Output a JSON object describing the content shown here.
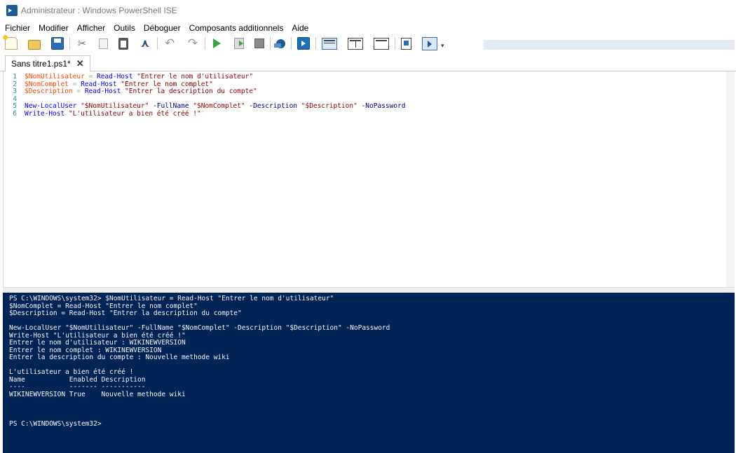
{
  "window": {
    "title": "Administrateur : Windows PowerShell ISE"
  },
  "menu": {
    "items": [
      "Fichier",
      "Modifier",
      "Afficher",
      "Outils",
      "Déboguer",
      "Composants additionnels",
      "Aide"
    ]
  },
  "toolbar": {
    "icons": [
      "new-script",
      "open",
      "save",
      "cut",
      "copy",
      "paste",
      "clear-console",
      "undo",
      "redo",
      "run-script",
      "run-selection",
      "stop",
      "new-remote-tab",
      "start-powershell",
      "show-script-top",
      "show-script-right",
      "show-script-maximized",
      "show-snippets",
      "show-commands-addon"
    ]
  },
  "tabs": [
    {
      "label": "Sans titre1.ps1*",
      "close": "✕"
    }
  ],
  "editor": {
    "line_numbers": [
      "1",
      "2",
      "3",
      "4",
      "5",
      "6"
    ],
    "lines": [
      [
        {
          "t": "var",
          "v": "$NomUtilisateur"
        },
        {
          "t": "op",
          "v": " = "
        },
        {
          "t": "cmd",
          "v": "Read-Host"
        },
        {
          "t": "plain",
          "v": " "
        },
        {
          "t": "str",
          "v": "\"Entrer le nom d'utilisateur\""
        }
      ],
      [
        {
          "t": "var",
          "v": "$NomComplet"
        },
        {
          "t": "op",
          "v": " = "
        },
        {
          "t": "cmd",
          "v": "Read-Host"
        },
        {
          "t": "plain",
          "v": " "
        },
        {
          "t": "str",
          "v": "\"Entrer le nom complet\""
        }
      ],
      [
        {
          "t": "var",
          "v": "$Description"
        },
        {
          "t": "op",
          "v": " = "
        },
        {
          "t": "cmd",
          "v": "Read-Host"
        },
        {
          "t": "plain",
          "v": " "
        },
        {
          "t": "str",
          "v": "\"Entrer la description du compte\""
        }
      ],
      [],
      [
        {
          "t": "cmd",
          "v": "New-LocalUser"
        },
        {
          "t": "plain",
          "v": " "
        },
        {
          "t": "str",
          "v": "\"$NomUtilisateur\""
        },
        {
          "t": "plain",
          "v": " "
        },
        {
          "t": "param",
          "v": "-FullName"
        },
        {
          "t": "plain",
          "v": " "
        },
        {
          "t": "str",
          "v": "\"$NomComplet\""
        },
        {
          "t": "plain",
          "v": " "
        },
        {
          "t": "param",
          "v": "-Description"
        },
        {
          "t": "plain",
          "v": " "
        },
        {
          "t": "str",
          "v": "\"$Description\""
        },
        {
          "t": "plain",
          "v": " "
        },
        {
          "t": "param",
          "v": "-NoPassword"
        }
      ],
      [
        {
          "t": "cmd",
          "v": "Write-Host"
        },
        {
          "t": "plain",
          "v": " "
        },
        {
          "t": "str",
          "v": "\"L'utilisateur a bien été créé !\""
        }
      ]
    ]
  },
  "console": {
    "lines": [
      "PS C:\\WINDOWS\\system32> $NomUtilisateur = Read-Host \"Entrer le nom d'utilisateur\"",
      "$NomComplet = Read-Host \"Entrer le nom complet\"",
      "$Description = Read-Host \"Entrer la description du compte\"",
      "",
      "New-LocalUser \"$NomUtilisateur\" -FullName \"$NomComplet\" -Description \"$Description\" -NoPassword",
      "Write-Host \"L'utilisateur a bien été créé !\"",
      "Entrer le nom d'utilisateur : WIKINEWVERSION",
      "Entrer le nom complet : WIKINEWVERSION",
      "Entrer la description du compte : Nouvelle methode wiki",
      "",
      "L'utilisateur a bien été créé !",
      "Name           Enabled Description",
      "----           ------- -----------",
      "WIKINEWVERSION True    Nouvelle methode wiki",
      "",
      "",
      "",
      "PS C:\\WINDOWS\\system32>"
    ]
  }
}
